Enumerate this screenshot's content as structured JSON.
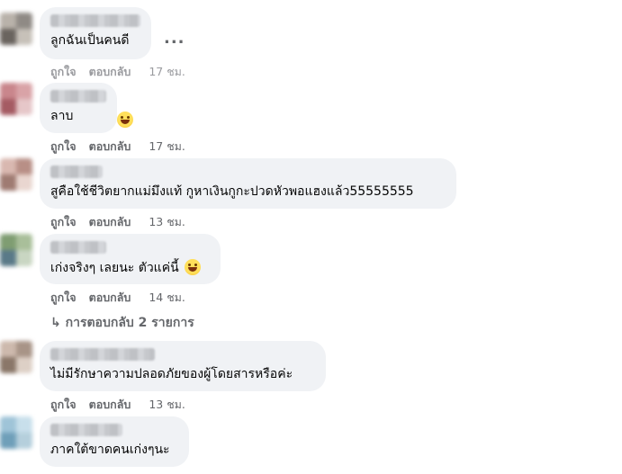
{
  "comments": [
    {
      "text": "ลูกฉันเป็นคนดี",
      "like": "ถูกใจ",
      "reply": "ตอบกลับ",
      "time": "17 ชม."
    },
    {
      "text": "ลาบ",
      "like": "ถูกใจ",
      "reply": "ตอบกลับ",
      "time": "17 ชม.",
      "emoji": "laughing-emoji"
    },
    {
      "text": "สูคือใช้ชีวิตยากแม่มึงแท้ กูหาเงินกูกะปวดหัวพอแฮงแล้ว55555555",
      "like": "ถูกใจ",
      "reply": "ตอบกลับ",
      "time": "13 ชม."
    },
    {
      "text": "เก่งจริงๆ เลยนะ ตัวแค่นี้",
      "like": "ถูกใจ",
      "reply": "ตอบกลับ",
      "time": "14 ชม.",
      "emoji": "grinning-emoji"
    },
    {
      "text": "ไม่มีรักษาความปลอดภัยของผู้โดยสารหรือค่ะ",
      "like": "ถูกใจ",
      "reply": "ตอบกลับ",
      "time": "13 ชม."
    },
    {
      "text": "ภาคใต้ขาดคนเก่งๆนะ"
    }
  ],
  "more_options": "...",
  "replies_link": "↳ การตอบกลับ 2 รายการ",
  "colors": {
    "bubble": "#f0f2f5",
    "meta": "#65676b",
    "text": "#050505"
  }
}
